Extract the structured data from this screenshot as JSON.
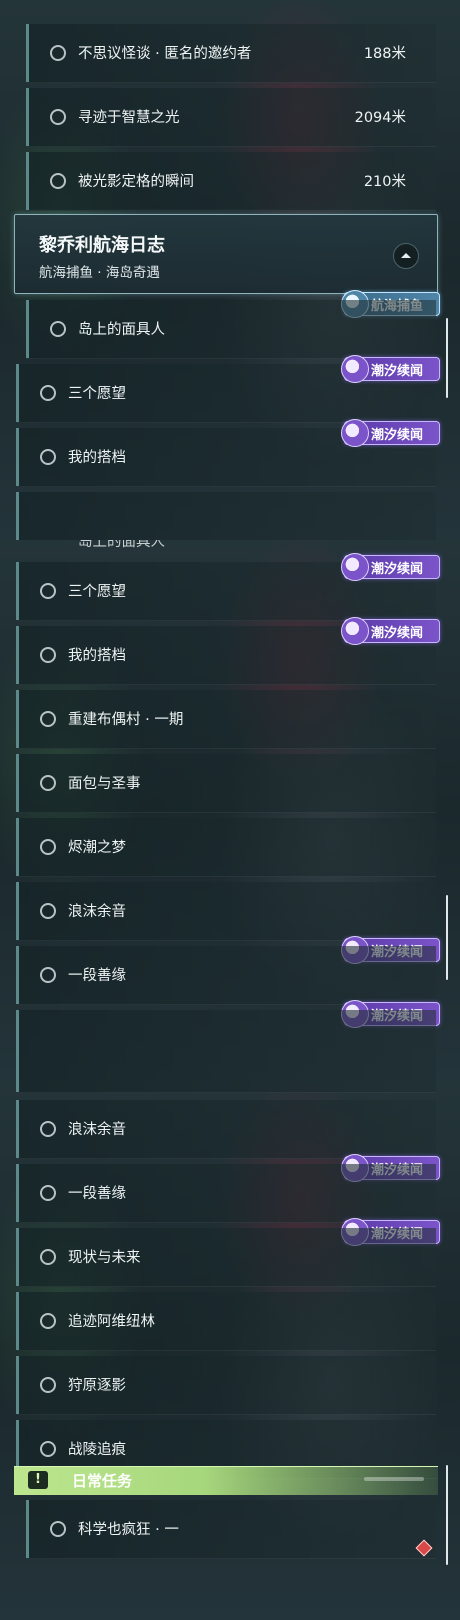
{
  "panel1": {
    "tasks_top": [
      {
        "label": "不思议怪谈 · 匿名的邀约者",
        "distance": "188米"
      },
      {
        "label": "寻迹于智慧之光",
        "distance": "2094米"
      },
      {
        "label": "被光影定格的瞬间",
        "distance": "210米"
      }
    ],
    "header": {
      "title": "黎乔利航海日志",
      "subtitle": "航海捕鱼 · 海岛奇遇"
    },
    "tasks_bottom": [
      {
        "label": "岛上的面具人"
      },
      {
        "label": "三个愿望"
      },
      {
        "label": "我的搭档"
      }
    ],
    "tags": {
      "blue": "航海捕鱼",
      "purple": "潮汐续闻"
    }
  },
  "panel2": {
    "cut_label": "岛上的面具人",
    "tasks": [
      {
        "label": "三个愿望"
      },
      {
        "label": "我的搭档"
      },
      {
        "label": "重建布偶村 · 一期"
      },
      {
        "label": "面包与圣事"
      },
      {
        "label": "烬潮之梦"
      },
      {
        "label": "浪沫余音"
      },
      {
        "label": "一段善缘"
      }
    ],
    "tag": "潮汐续闻"
  },
  "panel3": {
    "tasks": [
      {
        "label": "浪沫余音"
      },
      {
        "label": "一段善缘"
      },
      {
        "label": "现状与未来"
      },
      {
        "label": "追迹阿维纽林"
      },
      {
        "label": "狩原逐影"
      },
      {
        "label": "战陵追痕"
      }
    ],
    "tag": "潮汐续闻",
    "daily": {
      "badge": "!",
      "label": "日常任务"
    },
    "last_task": "科学也疯狂 · 一"
  },
  "colors": {
    "accent_purple": "#7b54c9",
    "accent_blue": "#4f86a8",
    "daily_green": "#bde68f",
    "alert_red": "#d94848"
  },
  "icons": {
    "radio": "radio-circle-icon",
    "collapse": "chevron-up-icon",
    "tag": "spiral-shell-icon",
    "daily": "exclamation-icon",
    "marker": "red-diamond-icon"
  }
}
